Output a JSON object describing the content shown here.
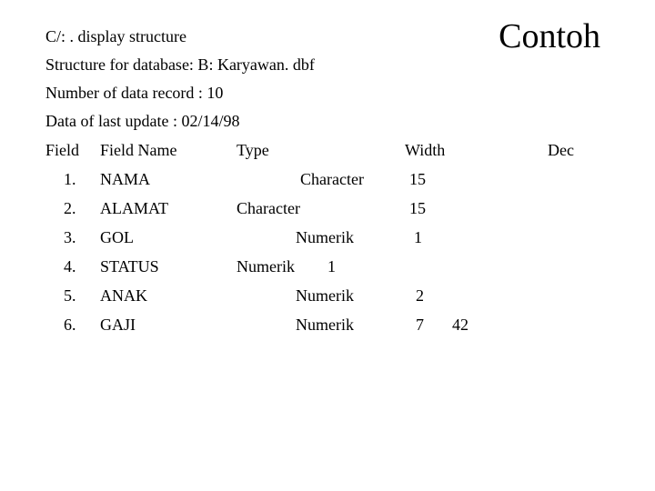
{
  "title": "Contoh",
  "lines": {
    "l1": "C/: . display structure",
    "l2": "Structure for database: B: Karyawan. dbf",
    "l3": "Number of data record : 10",
    "l4": "Data of last update : 02/14/98"
  },
  "header": {
    "field": "Field",
    "name": "Field Name",
    "type": "Type",
    "width": "Width",
    "dec": "Dec"
  },
  "rows": [
    {
      "num": "1.",
      "name": "NAMA",
      "type": "Character",
      "width": "15",
      "dec": ""
    },
    {
      "num": "2.",
      "name": "ALAMAT",
      "type": "Character",
      "width": "15",
      "dec": ""
    },
    {
      "num": "3.",
      "name": "GOL",
      "type": "Numerik",
      "width": "1",
      "dec": ""
    },
    {
      "num": "4.",
      "name": "STATUS",
      "type": "Numerik",
      "width": "1",
      "dec": ""
    },
    {
      "num": "5.",
      "name": "ANAK",
      "type": "Numerik",
      "width": "2",
      "dec": ""
    },
    {
      "num": "6.",
      "name": "GAJI",
      "type": "Numerik",
      "width": "7",
      "dec": "42"
    }
  ]
}
